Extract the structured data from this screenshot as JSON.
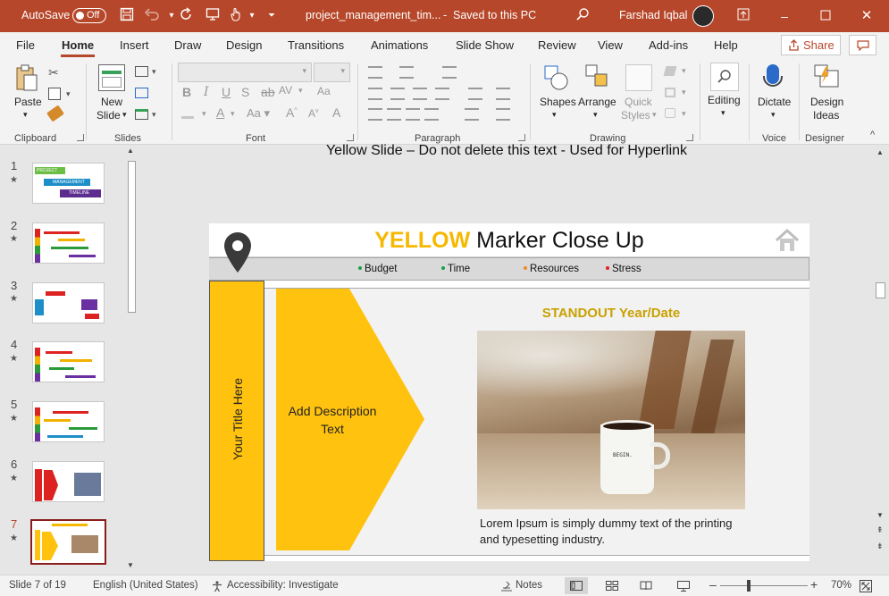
{
  "titlebar": {
    "autosave_label": "AutoSave",
    "autosave_state": "Off",
    "filename": "project_management_tim...",
    "save_status": "Saved to this PC",
    "user": "Farshad Iqbal"
  },
  "tabs": [
    "File",
    "Home",
    "Insert",
    "Draw",
    "Design",
    "Transitions",
    "Animations",
    "Slide Show",
    "Review",
    "View",
    "Add-ins",
    "Help"
  ],
  "share_label": "Share",
  "ribbon": {
    "groups": {
      "clipboard": "Clipboard",
      "slides": "Slides",
      "font": "Font",
      "paragraph": "Paragraph",
      "drawing": "Drawing",
      "voice": "Voice",
      "designer": "Designer"
    },
    "paste": "Paste",
    "new_slide_1": "New",
    "new_slide_2": "Slide",
    "shapes": "Shapes",
    "arrange": "Arrange",
    "quick_styles_1": "Quick",
    "quick_styles_2": "Styles",
    "editing": "Editing",
    "dictate": "Dictate",
    "design_ideas_1": "Design",
    "design_ideas_2": "Ideas"
  },
  "thumbnails": [
    {
      "num": "1"
    },
    {
      "num": "2"
    },
    {
      "num": "3"
    },
    {
      "num": "4"
    },
    {
      "num": "5"
    },
    {
      "num": "6"
    },
    {
      "num": "7"
    }
  ],
  "thumb_text": {
    "project": "PROJECT",
    "management": "MANAGEMENT",
    "timeline": "TIMELINE"
  },
  "slide_note": "Yellow Slide – Do not delete this text -  Used for Hyperlink",
  "slide": {
    "title_highlight": "YELLOW",
    "title_rest": " Marker Close Up",
    "legend": [
      {
        "label": "Budget",
        "color": "#1e9e4a"
      },
      {
        "label": "Time",
        "color": "#1e9e4a"
      },
      {
        "label": "Resources",
        "color": "#f08a24"
      },
      {
        "label": "Stress",
        "color": "#e02020"
      }
    ],
    "vertical_title": "Your Title Here",
    "arrow_text": "Add Description Text",
    "standout": "STANDOUT Year/Date",
    "mug_text": "BEGIN.",
    "lorem": "Lorem Ipsum is simply dummy text of the printing and typesetting industry."
  },
  "statusbar": {
    "slide_info": "Slide 7 of 19",
    "language": "English (United States)",
    "accessibility": "Accessibility: Investigate",
    "notes": "Notes",
    "zoom": "70%"
  },
  "colors": {
    "accent": "#b7472a",
    "yellow": "#ffc20e",
    "title_yellow": "#f6b800"
  }
}
